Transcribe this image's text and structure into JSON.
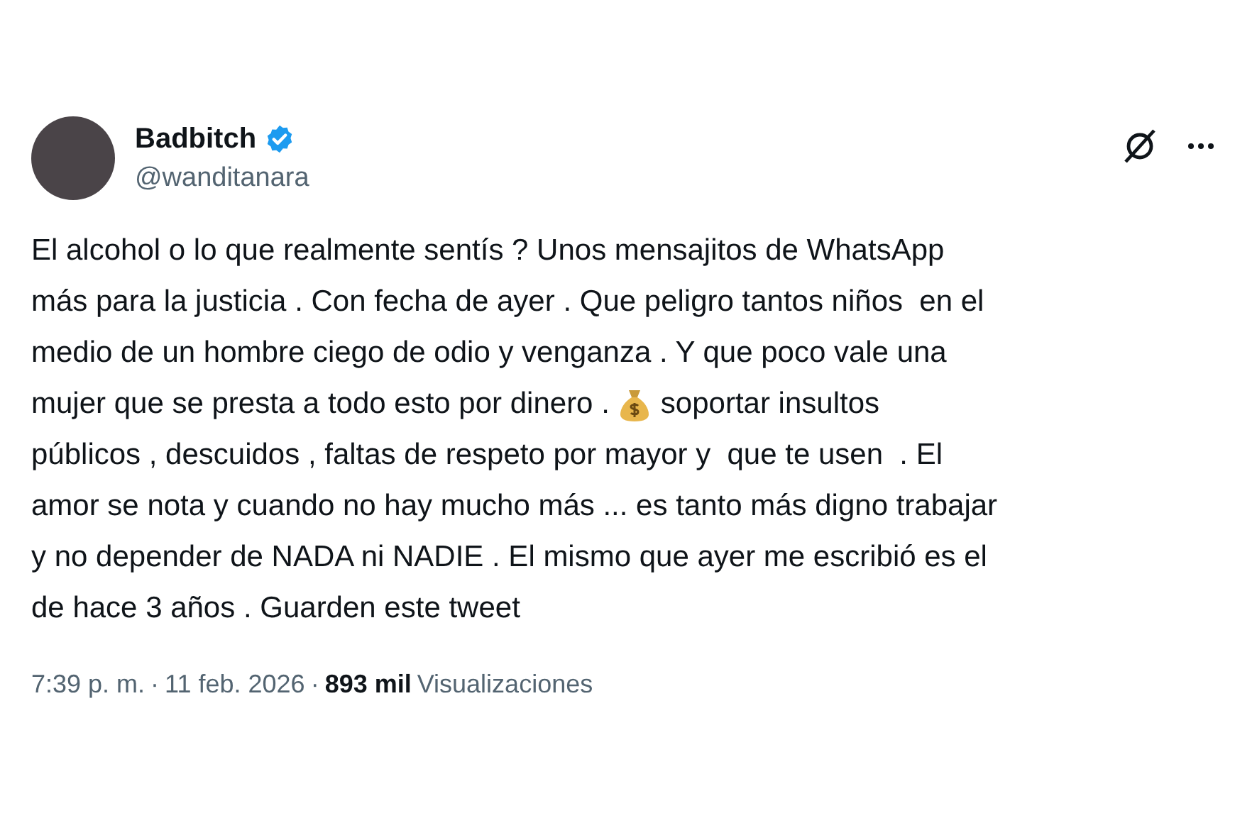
{
  "author": {
    "name": "Badbitch",
    "verified": true,
    "handle": "@wanditanara"
  },
  "body_lines": [
    [
      {
        "kind": "text",
        "text": "El alcohol o lo que realmente sentís ? Unos mensajitos de WhatsApp"
      }
    ],
    [
      {
        "kind": "text",
        "text": "más para la justicia . Con fecha de ayer . Que peligro tantos niños  en el"
      }
    ],
    [
      {
        "kind": "text",
        "text": "medio de un hombre ciego de odio y venganza . Y que poco vale una"
      }
    ],
    [
      {
        "kind": "text",
        "text": "mujer que se presta a todo esto por dinero ."
      },
      {
        "kind": "emoji"
      },
      {
        "kind": "text",
        "text": "soportar insultos"
      }
    ],
    [
      {
        "kind": "text",
        "text": "públicos , descuidos , faltas de respeto por mayor y  que te usen  . El"
      }
    ],
    [
      {
        "kind": "text",
        "text": "amor se nota y cuando no hay mucho más ... es tanto más digno trabajar"
      }
    ],
    [
      {
        "kind": "text",
        "text": "y no depender de NADA ni NADIE . El mismo que ayer me escribió es el"
      }
    ],
    [
      {
        "kind": "text",
        "text": "de hace 3 años . Guarden este tweet"
      }
    ]
  ],
  "meta": {
    "time": "7:39 p. m.",
    "separator_1": "·",
    "date": "11 feb. 2026",
    "separator_2": "·",
    "views_count": "893 mil",
    "views_label": "Visualizaciones"
  }
}
